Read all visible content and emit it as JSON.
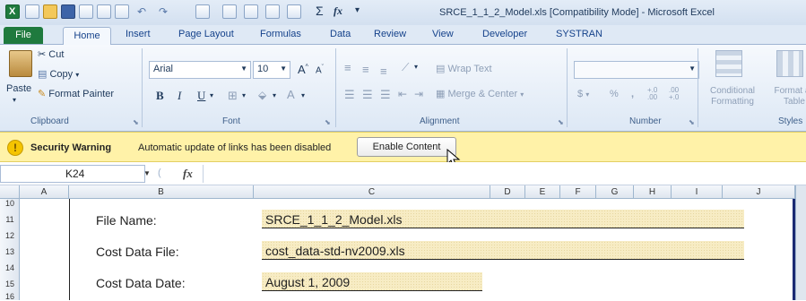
{
  "window": {
    "title": "SRCE_1_1_2_Model.xls  [Compatibility Mode]  -  Microsoft Excel"
  },
  "ribbon_tabs": [
    "File",
    "Home",
    "Insert",
    "Page Layout",
    "Formulas",
    "Data",
    "Review",
    "View",
    "Developer",
    "SYSTRAN"
  ],
  "clipboard": {
    "paste": "Paste",
    "cut": "Cut",
    "copy": "Copy",
    "format_painter": "Format Painter",
    "label": "Clipboard"
  },
  "font": {
    "name": "Arial",
    "size": "10",
    "label": "Font",
    "bold": "B",
    "italic": "I",
    "underline": "U",
    "grow": "A",
    "shrink": "A"
  },
  "alignment": {
    "wrap_text": "Wrap Text",
    "merge_center": "Merge & Center",
    "label": "Alignment"
  },
  "number": {
    "format_value": "",
    "currency": "$",
    "percent": "%",
    "comma": ",",
    "inc_decimal": "+.0 .00",
    "dec_decimal": ".00 +.0",
    "label": "Number"
  },
  "styles": {
    "conditional_formatting": "Conditional Formatting",
    "format_as_table": "Format as Table",
    "label": "Styles"
  },
  "security_bar": {
    "icon": "!",
    "title": "Security Warning",
    "message": "Automatic update of links has been disabled",
    "button": "Enable Content"
  },
  "formula_bar": {
    "name_box": "K24",
    "fx": "fx",
    "formula": ""
  },
  "columns": [
    "A",
    "B",
    "C",
    "D",
    "E",
    "F",
    "G",
    "H",
    "I",
    "J"
  ],
  "rows": [
    "10",
    "11",
    "12",
    "13",
    "14",
    "15",
    "16"
  ],
  "cells": [
    {
      "label": "File Name:",
      "value": "SRCE_1_1_2_Model.xls"
    },
    {
      "label": "Cost Data File:",
      "value": "cost_data-std-nv2009.xls"
    },
    {
      "label": "Cost Data Date:",
      "value": "August 1, 2009"
    }
  ],
  "colors": {
    "file_tab": "#1f7a3e",
    "security_bar": "#fff2a8",
    "cell_fill": "#f7ecc4"
  }
}
